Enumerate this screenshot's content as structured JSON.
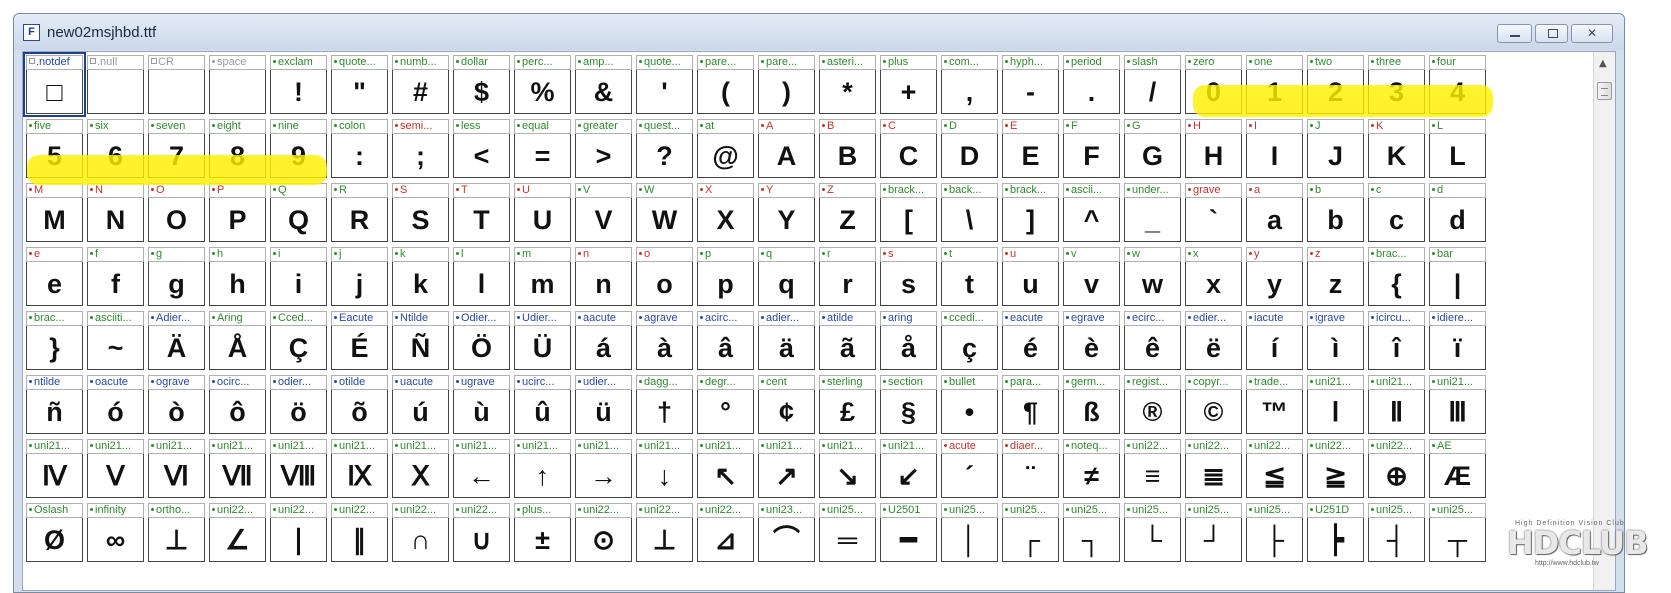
{
  "window": {
    "title": "new02msjhbd.ttf",
    "app_icon_letter": "F"
  },
  "cells": [
    {
      "name": ".notdef",
      "glyph": "□",
      "c": "blue",
      "m": 1
    },
    {
      "name": ".null",
      "glyph": "",
      "c": "gray",
      "m": 1
    },
    {
      "name": "CR",
      "glyph": "",
      "c": "gray",
      "m": 1
    },
    {
      "name": "space",
      "glyph": "",
      "c": "gray"
    },
    {
      "name": "exclam",
      "glyph": "!",
      "c": "green"
    },
    {
      "name": "quote...",
      "glyph": "\"",
      "c": "green"
    },
    {
      "name": "numb...",
      "glyph": "#",
      "c": "green"
    },
    {
      "name": "dollar",
      "glyph": "$",
      "c": "green"
    },
    {
      "name": "perc...",
      "glyph": "%",
      "c": "green"
    },
    {
      "name": "amp...",
      "glyph": "&",
      "c": "green"
    },
    {
      "name": "quote...",
      "glyph": "'",
      "c": "green"
    },
    {
      "name": "pare...",
      "glyph": "(",
      "c": "green"
    },
    {
      "name": "pare...",
      "glyph": ")",
      "c": "green"
    },
    {
      "name": "asteri...",
      "glyph": "*",
      "c": "green"
    },
    {
      "name": "plus",
      "glyph": "+",
      "c": "green"
    },
    {
      "name": "com...",
      "glyph": ",",
      "c": "green"
    },
    {
      "name": "hyph...",
      "glyph": "-",
      "c": "green"
    },
    {
      "name": "period",
      "glyph": ".",
      "c": "green"
    },
    {
      "name": "slash",
      "glyph": "/",
      "c": "green"
    },
    {
      "name": "zero",
      "glyph": "0",
      "c": "green"
    },
    {
      "name": "one",
      "glyph": "1",
      "c": "green"
    },
    {
      "name": "two",
      "glyph": "2",
      "c": "green"
    },
    {
      "name": "three",
      "glyph": "3",
      "c": "green"
    },
    {
      "name": "four",
      "glyph": "4",
      "c": "green"
    },
    {
      "name": "five",
      "glyph": "5",
      "c": "green"
    },
    {
      "name": "six",
      "glyph": "6",
      "c": "green"
    },
    {
      "name": "seven",
      "glyph": "7",
      "c": "green"
    },
    {
      "name": "eight",
      "glyph": "8",
      "c": "green"
    },
    {
      "name": "nine",
      "glyph": "9",
      "c": "green"
    },
    {
      "name": "colon",
      "glyph": ":",
      "c": "green"
    },
    {
      "name": "semi...",
      "glyph": ";",
      "c": "red"
    },
    {
      "name": "less",
      "glyph": "<",
      "c": "green"
    },
    {
      "name": "equal",
      "glyph": "=",
      "c": "green"
    },
    {
      "name": "greater",
      "glyph": ">",
      "c": "green"
    },
    {
      "name": "quest...",
      "glyph": "?",
      "c": "green"
    },
    {
      "name": "at",
      "glyph": "@",
      "c": "green"
    },
    {
      "name": "A",
      "glyph": "A",
      "c": "red"
    },
    {
      "name": "B",
      "glyph": "B",
      "c": "red"
    },
    {
      "name": "C",
      "glyph": "C",
      "c": "red"
    },
    {
      "name": "D",
      "glyph": "D",
      "c": "green"
    },
    {
      "name": "E",
      "glyph": "E",
      "c": "red"
    },
    {
      "name": "F",
      "glyph": "F",
      "c": "green"
    },
    {
      "name": "G",
      "glyph": "G",
      "c": "green"
    },
    {
      "name": "H",
      "glyph": "H",
      "c": "red"
    },
    {
      "name": "I",
      "glyph": "I",
      "c": "red"
    },
    {
      "name": "J",
      "glyph": "J",
      "c": "green"
    },
    {
      "name": "K",
      "glyph": "K",
      "c": "red"
    },
    {
      "name": "L",
      "glyph": "L",
      "c": "green"
    },
    {
      "name": "M",
      "glyph": "M",
      "c": "red"
    },
    {
      "name": "N",
      "glyph": "N",
      "c": "red"
    },
    {
      "name": "O",
      "glyph": "O",
      "c": "red"
    },
    {
      "name": "P",
      "glyph": "P",
      "c": "red"
    },
    {
      "name": "Q",
      "glyph": "Q",
      "c": "green"
    },
    {
      "name": "R",
      "glyph": "R",
      "c": "green"
    },
    {
      "name": "S",
      "glyph": "S",
      "c": "red"
    },
    {
      "name": "T",
      "glyph": "T",
      "c": "red"
    },
    {
      "name": "U",
      "glyph": "U",
      "c": "red"
    },
    {
      "name": "V",
      "glyph": "V",
      "c": "green"
    },
    {
      "name": "W",
      "glyph": "W",
      "c": "green"
    },
    {
      "name": "X",
      "glyph": "X",
      "c": "red"
    },
    {
      "name": "Y",
      "glyph": "Y",
      "c": "red"
    },
    {
      "name": "Z",
      "glyph": "Z",
      "c": "red"
    },
    {
      "name": "brack...",
      "glyph": "[",
      "c": "green"
    },
    {
      "name": "back...",
      "glyph": "\\",
      "c": "green"
    },
    {
      "name": "brack...",
      "glyph": "]",
      "c": "green"
    },
    {
      "name": "ascii...",
      "glyph": "^",
      "c": "green"
    },
    {
      "name": "under...",
      "glyph": "_",
      "c": "green"
    },
    {
      "name": "grave",
      "glyph": "`",
      "c": "red"
    },
    {
      "name": "a",
      "glyph": "a",
      "c": "red"
    },
    {
      "name": "b",
      "glyph": "b",
      "c": "green"
    },
    {
      "name": "c",
      "glyph": "c",
      "c": "green"
    },
    {
      "name": "d",
      "glyph": "d",
      "c": "green"
    },
    {
      "name": "e",
      "glyph": "e",
      "c": "red"
    },
    {
      "name": "f",
      "glyph": "f",
      "c": "green"
    },
    {
      "name": "g",
      "glyph": "g",
      "c": "green"
    },
    {
      "name": "h",
      "glyph": "h",
      "c": "green"
    },
    {
      "name": "i",
      "glyph": "i",
      "c": "green"
    },
    {
      "name": "j",
      "glyph": "j",
      "c": "green"
    },
    {
      "name": "k",
      "glyph": "k",
      "c": "green"
    },
    {
      "name": "l",
      "glyph": "l",
      "c": "green"
    },
    {
      "name": "m",
      "glyph": "m",
      "c": "green"
    },
    {
      "name": "n",
      "glyph": "n",
      "c": "red"
    },
    {
      "name": "o",
      "glyph": "o",
      "c": "red"
    },
    {
      "name": "p",
      "glyph": "p",
      "c": "green"
    },
    {
      "name": "q",
      "glyph": "q",
      "c": "green"
    },
    {
      "name": "r",
      "glyph": "r",
      "c": "green"
    },
    {
      "name": "s",
      "glyph": "s",
      "c": "red"
    },
    {
      "name": "t",
      "glyph": "t",
      "c": "green"
    },
    {
      "name": "u",
      "glyph": "u",
      "c": "red"
    },
    {
      "name": "v",
      "glyph": "v",
      "c": "green"
    },
    {
      "name": "w",
      "glyph": "w",
      "c": "green"
    },
    {
      "name": "x",
      "glyph": "x",
      "c": "green"
    },
    {
      "name": "y",
      "glyph": "y",
      "c": "red"
    },
    {
      "name": "z",
      "glyph": "z",
      "c": "red"
    },
    {
      "name": "brac...",
      "glyph": "{",
      "c": "green"
    },
    {
      "name": "bar",
      "glyph": "|",
      "c": "green"
    },
    {
      "name": "brac...",
      "glyph": "}",
      "c": "green"
    },
    {
      "name": "asciiti...",
      "glyph": "~",
      "c": "green"
    },
    {
      "name": "Adier...",
      "glyph": "Ä",
      "c": "blue"
    },
    {
      "name": "Aring",
      "glyph": "Å",
      "c": "green"
    },
    {
      "name": "Cced...",
      "glyph": "Ç",
      "c": "green"
    },
    {
      "name": "Eacute",
      "glyph": "É",
      "c": "blue"
    },
    {
      "name": "Ntilde",
      "glyph": "Ñ",
      "c": "blue"
    },
    {
      "name": "Odier...",
      "glyph": "Ö",
      "c": "blue"
    },
    {
      "name": "Udier...",
      "glyph": "Ü",
      "c": "blue"
    },
    {
      "name": "aacute",
      "glyph": "á",
      "c": "blue"
    },
    {
      "name": "agrave",
      "glyph": "à",
      "c": "blue"
    },
    {
      "name": "acirc...",
      "glyph": "â",
      "c": "blue"
    },
    {
      "name": "adier...",
      "glyph": "ä",
      "c": "blue"
    },
    {
      "name": "atilde",
      "glyph": "ã",
      "c": "blue"
    },
    {
      "name": "aring",
      "glyph": "å",
      "c": "blue"
    },
    {
      "name": "ccedi...",
      "glyph": "ç",
      "c": "green"
    },
    {
      "name": "eacute",
      "glyph": "é",
      "c": "blue"
    },
    {
      "name": "egrave",
      "glyph": "è",
      "c": "blue"
    },
    {
      "name": "ecirc...",
      "glyph": "ê",
      "c": "blue"
    },
    {
      "name": "edier...",
      "glyph": "ë",
      "c": "blue"
    },
    {
      "name": "iacute",
      "glyph": "í",
      "c": "blue"
    },
    {
      "name": "igrave",
      "glyph": "ì",
      "c": "blue"
    },
    {
      "name": "icircu...",
      "glyph": "î",
      "c": "blue"
    },
    {
      "name": "idiere...",
      "glyph": "ï",
      "c": "blue"
    },
    {
      "name": "ntilde",
      "glyph": "ñ",
      "c": "blue"
    },
    {
      "name": "oacute",
      "glyph": "ó",
      "c": "blue"
    },
    {
      "name": "ograve",
      "glyph": "ò",
      "c": "blue"
    },
    {
      "name": "ocirc...",
      "glyph": "ô",
      "c": "blue"
    },
    {
      "name": "odier...",
      "glyph": "ö",
      "c": "blue"
    },
    {
      "name": "otilde",
      "glyph": "õ",
      "c": "blue"
    },
    {
      "name": "uacute",
      "glyph": "ú",
      "c": "blue"
    },
    {
      "name": "ugrave",
      "glyph": "ù",
      "c": "blue"
    },
    {
      "name": "ucirc...",
      "glyph": "û",
      "c": "blue"
    },
    {
      "name": "udier...",
      "glyph": "ü",
      "c": "blue"
    },
    {
      "name": "dagg...",
      "glyph": "†",
      "c": "green"
    },
    {
      "name": "degr...",
      "glyph": "°",
      "c": "green"
    },
    {
      "name": "cent",
      "glyph": "¢",
      "c": "green"
    },
    {
      "name": "sterling",
      "glyph": "£",
      "c": "green"
    },
    {
      "name": "section",
      "glyph": "§",
      "c": "green"
    },
    {
      "name": "bullet",
      "glyph": "•",
      "c": "green"
    },
    {
      "name": "para...",
      "glyph": "¶",
      "c": "green"
    },
    {
      "name": "germ...",
      "glyph": "ß",
      "c": "green"
    },
    {
      "name": "regist...",
      "glyph": "®",
      "c": "green"
    },
    {
      "name": "copyr...",
      "glyph": "©",
      "c": "green"
    },
    {
      "name": "trade...",
      "glyph": "™",
      "c": "green"
    },
    {
      "name": "uni21...",
      "glyph": "Ⅰ",
      "c": "green"
    },
    {
      "name": "uni21...",
      "glyph": "Ⅱ",
      "c": "green"
    },
    {
      "name": "uni21...",
      "glyph": "Ⅲ",
      "c": "green"
    },
    {
      "name": "uni21...",
      "glyph": "Ⅳ",
      "c": "green"
    },
    {
      "name": "uni21...",
      "glyph": "Ⅴ",
      "c": "green"
    },
    {
      "name": "uni21...",
      "glyph": "Ⅵ",
      "c": "green"
    },
    {
      "name": "uni21...",
      "glyph": "Ⅶ",
      "c": "green"
    },
    {
      "name": "uni21...",
      "glyph": "Ⅷ",
      "c": "green"
    },
    {
      "name": "uni21...",
      "glyph": "Ⅸ",
      "c": "green"
    },
    {
      "name": "uni21...",
      "glyph": "Ⅹ",
      "c": "green"
    },
    {
      "name": "uni21...",
      "glyph": "←",
      "c": "green"
    },
    {
      "name": "uni21...",
      "glyph": "↑",
      "c": "green"
    },
    {
      "name": "uni21...",
      "glyph": "→",
      "c": "green"
    },
    {
      "name": "uni21...",
      "glyph": "↓",
      "c": "green"
    },
    {
      "name": "uni21...",
      "glyph": "↖",
      "c": "green"
    },
    {
      "name": "uni21...",
      "glyph": "↗",
      "c": "green"
    },
    {
      "name": "uni21...",
      "glyph": "↘",
      "c": "green"
    },
    {
      "name": "uni21...",
      "glyph": "↙",
      "c": "green"
    },
    {
      "name": "acute",
      "glyph": "´",
      "c": "red"
    },
    {
      "name": "diaer...",
      "glyph": "¨",
      "c": "red"
    },
    {
      "name": "noteq...",
      "glyph": "≠",
      "c": "green"
    },
    {
      "name": "uni22...",
      "glyph": "≡",
      "c": "green"
    },
    {
      "name": "uni22...",
      "glyph": "≣",
      "c": "green"
    },
    {
      "name": "uni22...",
      "glyph": "≦",
      "c": "green"
    },
    {
      "name": "uni22...",
      "glyph": "≧",
      "c": "green"
    },
    {
      "name": "uni22...",
      "glyph": "⊕",
      "c": "green"
    },
    {
      "name": "AE",
      "glyph": "Æ",
      "c": "green"
    },
    {
      "name": "Oslash",
      "glyph": "Ø",
      "c": "green"
    },
    {
      "name": "infinity",
      "glyph": "∞",
      "c": "green"
    },
    {
      "name": "ortho...",
      "glyph": "⊥",
      "c": "green"
    },
    {
      "name": "uni22...",
      "glyph": "∠",
      "c": "green"
    },
    {
      "name": "uni22...",
      "glyph": "∣",
      "c": "green"
    },
    {
      "name": "uni22...",
      "glyph": "∥",
      "c": "green"
    },
    {
      "name": "uni22...",
      "glyph": "∩",
      "c": "green"
    },
    {
      "name": "uni22...",
      "glyph": "∪",
      "c": "green"
    },
    {
      "name": "plus...",
      "glyph": "±",
      "c": "green"
    },
    {
      "name": "uni22...",
      "glyph": "⊙",
      "c": "green"
    },
    {
      "name": "uni22...",
      "glyph": "⊥",
      "c": "green"
    },
    {
      "name": "uni22...",
      "glyph": "⊿",
      "c": "green"
    },
    {
      "name": "uni23...",
      "glyph": "⌒",
      "c": "green"
    },
    {
      "name": "uni25...",
      "glyph": "═",
      "c": "green"
    },
    {
      "name": "U2501",
      "glyph": "━",
      "c": "green"
    },
    {
      "name": "uni25...",
      "glyph": "│",
      "c": "green"
    },
    {
      "name": "uni25...",
      "glyph": "┌",
      "c": "green"
    },
    {
      "name": "uni25...",
      "glyph": "┐",
      "c": "green"
    },
    {
      "name": "uni25...",
      "glyph": "└",
      "c": "green"
    },
    {
      "name": "uni25...",
      "glyph": "┘",
      "c": "green"
    },
    {
      "name": "uni25...",
      "glyph": "├",
      "c": "green"
    },
    {
      "name": "U251D",
      "glyph": "┝",
      "c": "green"
    },
    {
      "name": "uni25...",
      "glyph": "┤",
      "c": "green"
    },
    {
      "name": "uni25...",
      "glyph": "┬",
      "c": "green"
    }
  ],
  "watermark": {
    "small": "High Definition Vision Club",
    "big": "HDCLUB",
    "url": "http://www.hdclub.tw"
  }
}
